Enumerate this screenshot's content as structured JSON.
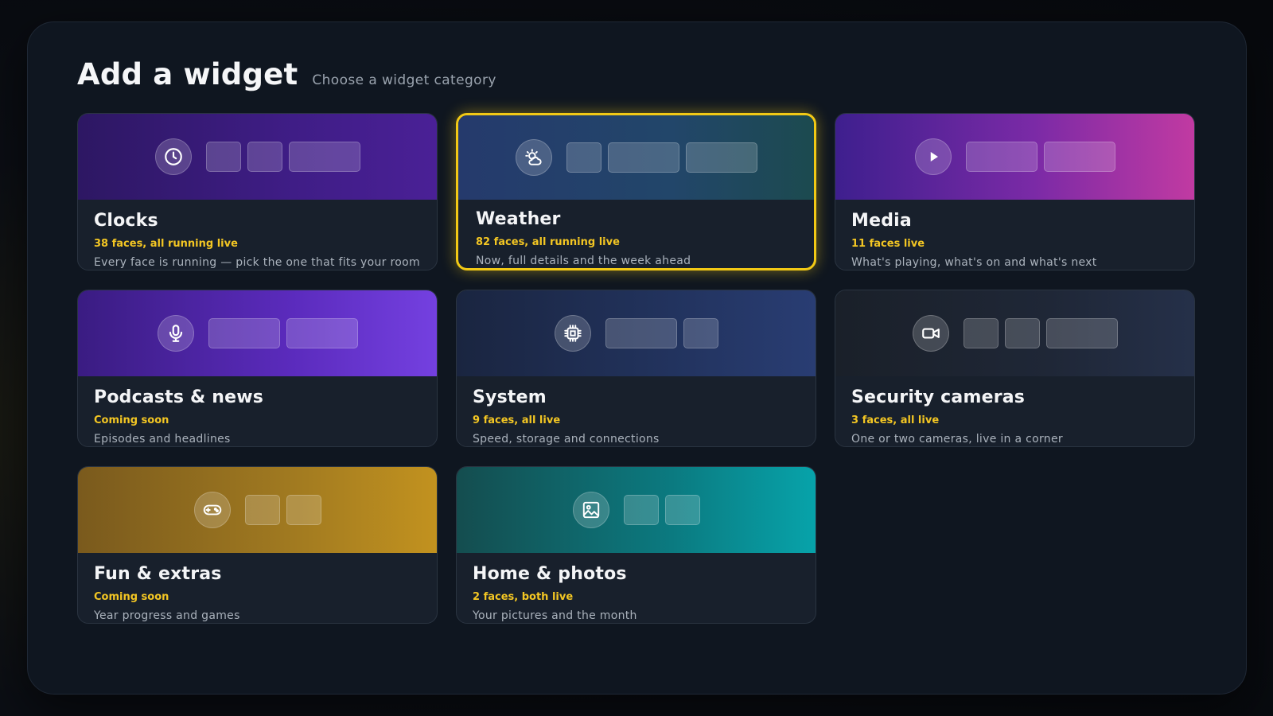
{
  "header": {
    "title": "Add a widget",
    "subtitle": "Choose a widget category"
  },
  "categories": [
    {
      "title": "Clocks",
      "status": "38 faces, all running live",
      "description": "Every face is running — pick the one that fits your room",
      "icon": "clock-icon",
      "selected": false
    },
    {
      "title": "Weather",
      "status": "82 faces, all running live",
      "description": "Now, full details and the week ahead",
      "icon": "sun-cloud-icon",
      "selected": true
    },
    {
      "title": "Media",
      "status": "11 faces live",
      "description": "What's playing, what's on and what's next",
      "icon": "play-icon",
      "selected": false
    },
    {
      "title": "Podcasts & news",
      "status": "Coming soon",
      "description": "Episodes and headlines",
      "icon": "microphone-icon",
      "selected": false
    },
    {
      "title": "System",
      "status": "9 faces, all live",
      "description": "Speed, storage and connections",
      "icon": "cpu-chip-icon",
      "selected": false
    },
    {
      "title": "Security cameras",
      "status": "3 faces, all live",
      "description": "One or two cameras, live in a corner",
      "icon": "video-camera-icon",
      "selected": false
    },
    {
      "title": "Fun & extras",
      "status": "Coming soon",
      "description": "Year progress and games",
      "icon": "gamepad-icon",
      "selected": false
    },
    {
      "title": "Home & photos",
      "status": "2 faces, both live",
      "description": "Your pictures and the month",
      "icon": "image-icon",
      "selected": false
    }
  ],
  "colors": {
    "accent": "#f2c915",
    "status_text": "#f3c623",
    "panel": "#0f1620",
    "card": "#18202c"
  }
}
